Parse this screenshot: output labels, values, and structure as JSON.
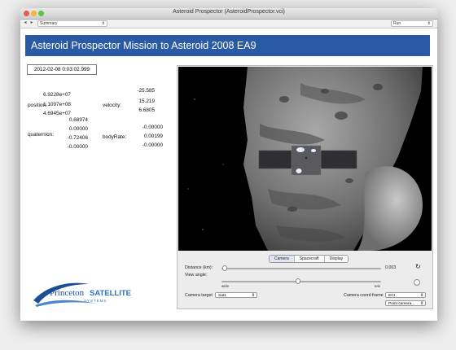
{
  "window": {
    "title": "Asteroid Prospector (AsteroidProspector.vci)"
  },
  "toolbar": {
    "view_select": "Summary",
    "run_select": "Run"
  },
  "header": {
    "title": "Asteroid Prospector Mission to Asteroid 2008 EA9",
    "banner_color": "#2a5aa3"
  },
  "state": {
    "timestamp": "2012-02-08 0:03:02.999",
    "position_label": "position:",
    "position": [
      "6.9228e+07",
      "1.1097e+08",
      "4.6945e+07"
    ],
    "velocity_label": "velocity:",
    "velocity": [
      "-25.585",
      "15.219",
      "6.6805"
    ],
    "quaternion_label": "quaternion:",
    "quaternion": [
      "0.68974",
      "0.00000",
      "-0.72406",
      "-0.00000"
    ],
    "bodyrate_label": "bodyRate:",
    "bodyrate": [
      "-0.00000",
      "0.00199",
      "-0.00000"
    ]
  },
  "logo": {
    "line1": "Princeton",
    "line2": "SATELLITE",
    "line3": "SYSTEMS"
  },
  "viewer": {
    "tabs": [
      "Camera",
      "Spacecraft",
      "Display"
    ],
    "active_tab": "Camera",
    "distance_label": "Distance (km):",
    "distance_value": "0.003",
    "distance_fraction": 0.02,
    "view_angle_label": "View angle:",
    "view_angle_fraction": 0.48,
    "wide_label": "wide",
    "tele_label": "tele",
    "camera_target_label": "Camera target",
    "camera_target_value": "Sat1",
    "camera_frame_label": "Camera coord frame",
    "camera_frame_value": "ECI",
    "point_camera_value": "Point camera..."
  }
}
